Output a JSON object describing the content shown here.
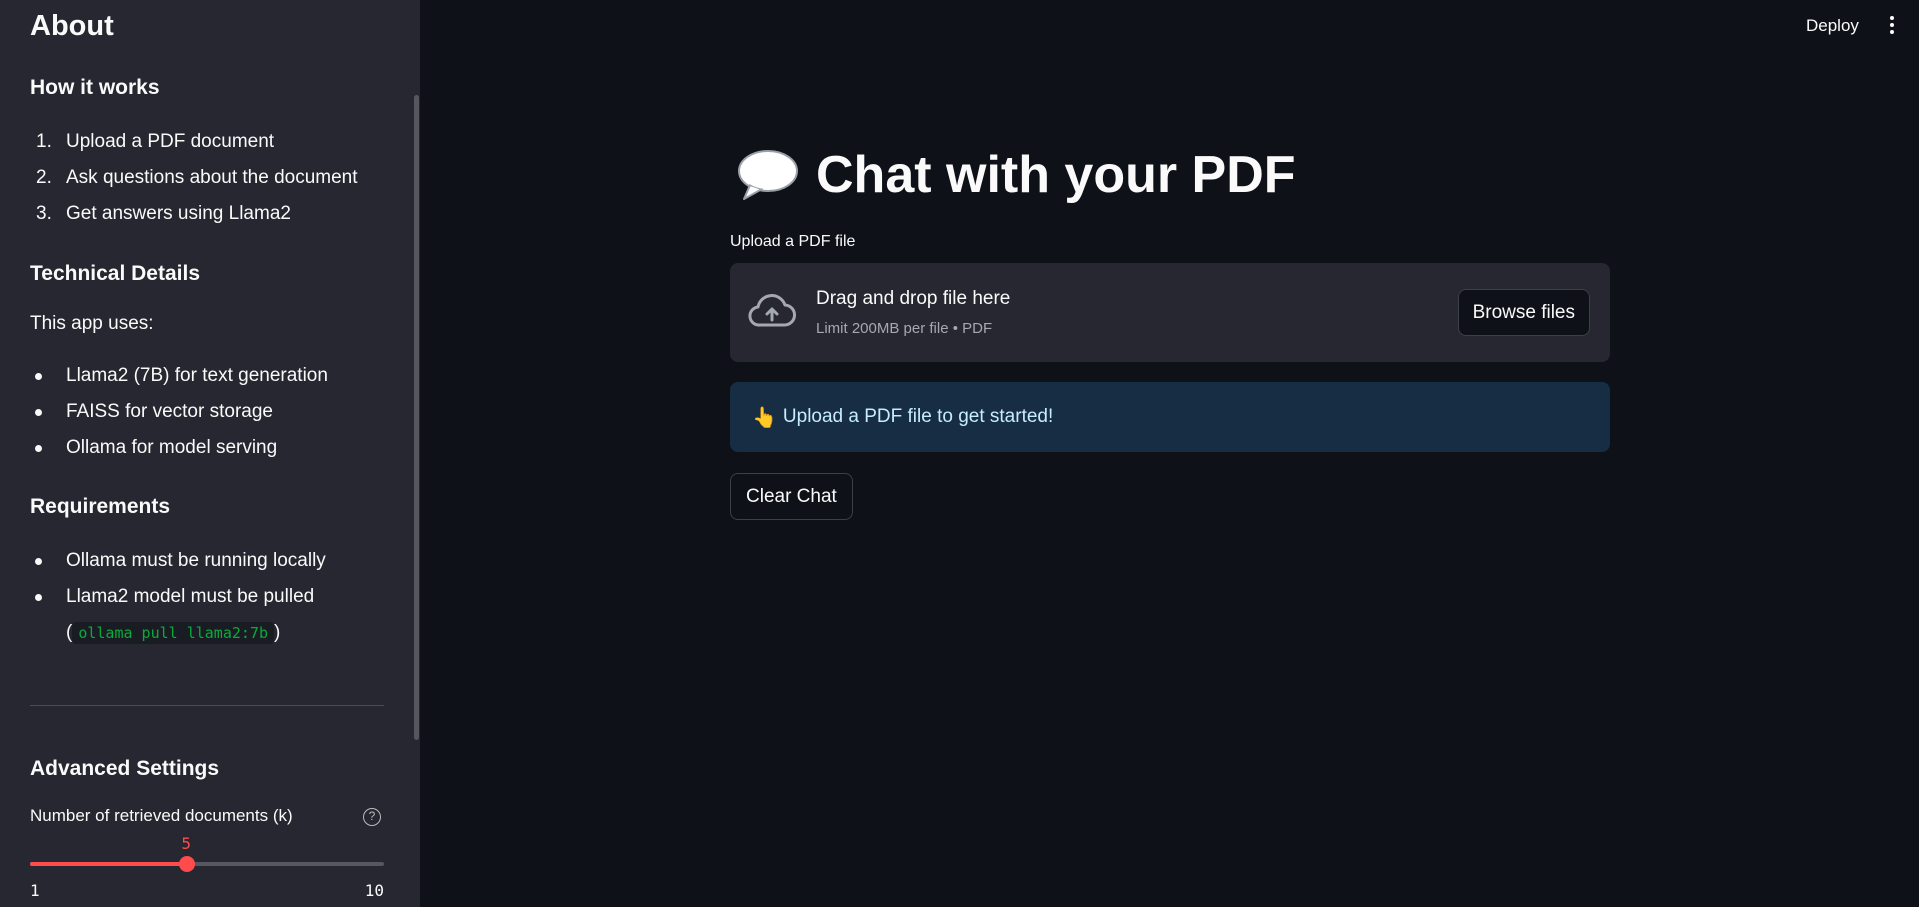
{
  "sidebar": {
    "title": "About",
    "how_it_works": {
      "heading": "How it works",
      "items": [
        {
          "marker": "1.",
          "label": "Upload a PDF document"
        },
        {
          "marker": "2.",
          "label": "Ask questions about the document"
        },
        {
          "marker": "3.",
          "label": "Get answers using Llama2"
        }
      ]
    },
    "technical": {
      "heading": "Technical Details",
      "intro": "This app uses:",
      "items": [
        "Llama2 (7B) for text generation",
        "FAISS for vector storage",
        "Ollama for model serving"
      ]
    },
    "requirements": {
      "heading": "Requirements",
      "item1": "Ollama must be running locally",
      "item2": "Llama2 model must be pulled",
      "paren_open": "(",
      "code": "ollama pull llama2:7b",
      "paren_close": ")"
    },
    "advanced": {
      "heading": "Advanced Settings",
      "slider": {
        "label": "Number of retrieved documents (k)",
        "help_icon": "?",
        "value": 5,
        "min": 1,
        "max": 10
      }
    }
  },
  "header": {
    "deploy_label": "Deploy",
    "menu_icon": "kebab-menu-icon"
  },
  "main": {
    "title_icon": "speech-bubble-icon",
    "title": "Chat with your PDF",
    "uploader": {
      "label": "Upload a PDF file",
      "icon": "cloud-upload-icon",
      "drop_text": "Drag and drop file here",
      "limit_text": "Limit 200MB per file • PDF",
      "browse_label": "Browse files"
    },
    "info": {
      "emoji": "👆",
      "text": "Upload a PDF file to get started!"
    },
    "clear_label": "Clear Chat"
  },
  "colors": {
    "background": "#0e1117",
    "sidebar": "#262730",
    "accent": "#ff4b4b",
    "info_bg": "#172d43",
    "info_text": "#c7ebff",
    "code_text": "#09ab3b"
  }
}
